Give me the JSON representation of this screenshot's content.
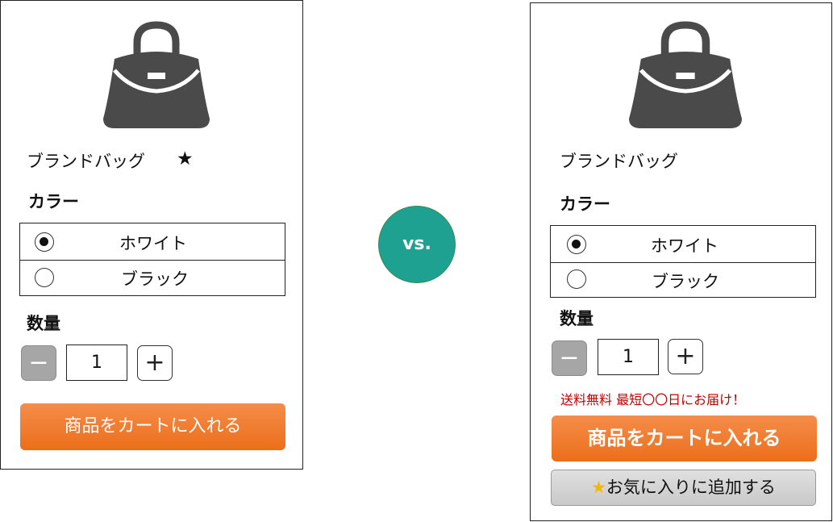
{
  "variant_a": {
    "product_name": "ブランドバッグ",
    "rating_star": "★",
    "color_heading": "カラー",
    "color_options": [
      {
        "label": "ホワイト",
        "selected": true
      },
      {
        "label": "ブラック",
        "selected": false
      }
    ],
    "quantity_heading": "数量",
    "quantity_value": "1",
    "minus_symbol": "−",
    "plus_symbol": "+",
    "cart_button": "商品をカートに入れる"
  },
  "vs_label": "vs.",
  "variant_b": {
    "product_name": "ブランドバッグ",
    "color_heading": "カラー",
    "color_options": [
      {
        "label": "ホワイト",
        "selected": true
      },
      {
        "label": "ブラック",
        "selected": false
      }
    ],
    "quantity_heading": "数量",
    "quantity_value": "1",
    "minus_symbol": "−",
    "plus_symbol": "+",
    "shipping_note": "送料無料 最短〇〇日にお届け！",
    "cart_button": "商品をカートに入れる",
    "favorite_star": "★",
    "favorite_button": "お気に入りに追加する"
  },
  "colors": {
    "cart_orange": "#ec6e1a",
    "vs_teal": "#1fa192",
    "shipping_red": "#c00000",
    "star_gold": "#f5b800",
    "bag_gray": "#4a4a4a"
  }
}
